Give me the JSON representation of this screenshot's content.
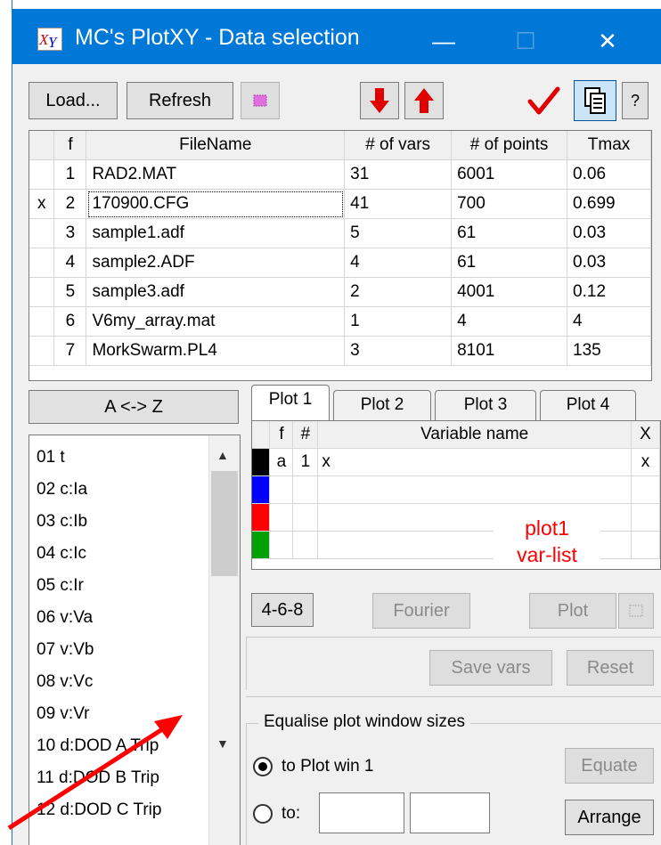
{
  "window": {
    "title": "MC's PlotXY - Data selection",
    "minimize_glyph": "—",
    "maximize_glyph": "☐",
    "close_glyph": "✕"
  },
  "toolbar": {
    "load_label": "Load...",
    "refresh_label": "Refresh",
    "help_label": "?"
  },
  "file_table": {
    "columns": [
      "",
      "f",
      "FileName",
      "# of vars",
      "# of points",
      "Tmax"
    ],
    "rows": [
      {
        "sel": "",
        "f": "1",
        "name": "RAD2.MAT",
        "vars": "31",
        "points": "6001",
        "tmax": "0.06"
      },
      {
        "sel": "x",
        "f": "2",
        "name": "170900.CFG",
        "vars": "41",
        "points": "700",
        "tmax": "0.699"
      },
      {
        "sel": "",
        "f": "3",
        "name": "sample1.adf",
        "vars": "5",
        "points": "61",
        "tmax": "0.03"
      },
      {
        "sel": "",
        "f": "4",
        "name": "sample2.ADF",
        "vars": "4",
        "points": "61",
        "tmax": "0.03"
      },
      {
        "sel": "",
        "f": "5",
        "name": "sample3.adf",
        "vars": "2",
        "points": "4001",
        "tmax": "0.12"
      },
      {
        "sel": "",
        "f": "6",
        "name": "V6my_array.mat",
        "vars": "1",
        "points": "4",
        "tmax": "4"
      },
      {
        "sel": "",
        "f": "7",
        "name": "MorkSwarm.PL4",
        "vars": "3",
        "points": "8101",
        "tmax": "135"
      }
    ]
  },
  "sort_button_label": "A <-> Z",
  "variables": [
    "01  t",
    "02  c:Ia",
    "03  c:Ib",
    "04  c:Ic",
    "05  c:Ir",
    "06  v:Va",
    "07  v:Vb",
    "08  v:Vc",
    "09  v:Vr",
    "10  d:DOD A Trip",
    "11  d:DOD B Trip",
    "12  d:DOD C Trip"
  ],
  "tabs": [
    "Plot 1",
    "Plot 2",
    "Plot 3",
    "Plot 4"
  ],
  "plot_table": {
    "columns": [
      "f",
      "#",
      "Variable name",
      "X"
    ],
    "rows": [
      {
        "color": "#000000",
        "f": "a",
        "n": "1",
        "name": "x",
        "x": "x"
      },
      {
        "color": "#0000ff",
        "f": "",
        "n": "",
        "name": "",
        "x": ""
      },
      {
        "color": "#ff0000",
        "f": "",
        "n": "",
        "name": "",
        "x": ""
      },
      {
        "color": "#00a000",
        "f": "",
        "n": "",
        "name": "",
        "x": ""
      }
    ]
  },
  "annotation": {
    "line1": "plot1",
    "line2": "var-list",
    "color": "#ff0000"
  },
  "buttons": {
    "four_six_eight": "4-6-8",
    "fourier": "Fourier",
    "plot": "Plot",
    "save_vars": "Save vars",
    "reset": "Reset",
    "equate": "Equate",
    "arrange": "Arrange"
  },
  "equalise": {
    "legend": "Equalise plot window sizes",
    "option1": "to Plot win 1",
    "option2": "to:",
    "selected": "option1"
  },
  "colors": {
    "titlebar": "#0078d7",
    "arrow": "#e00000"
  }
}
